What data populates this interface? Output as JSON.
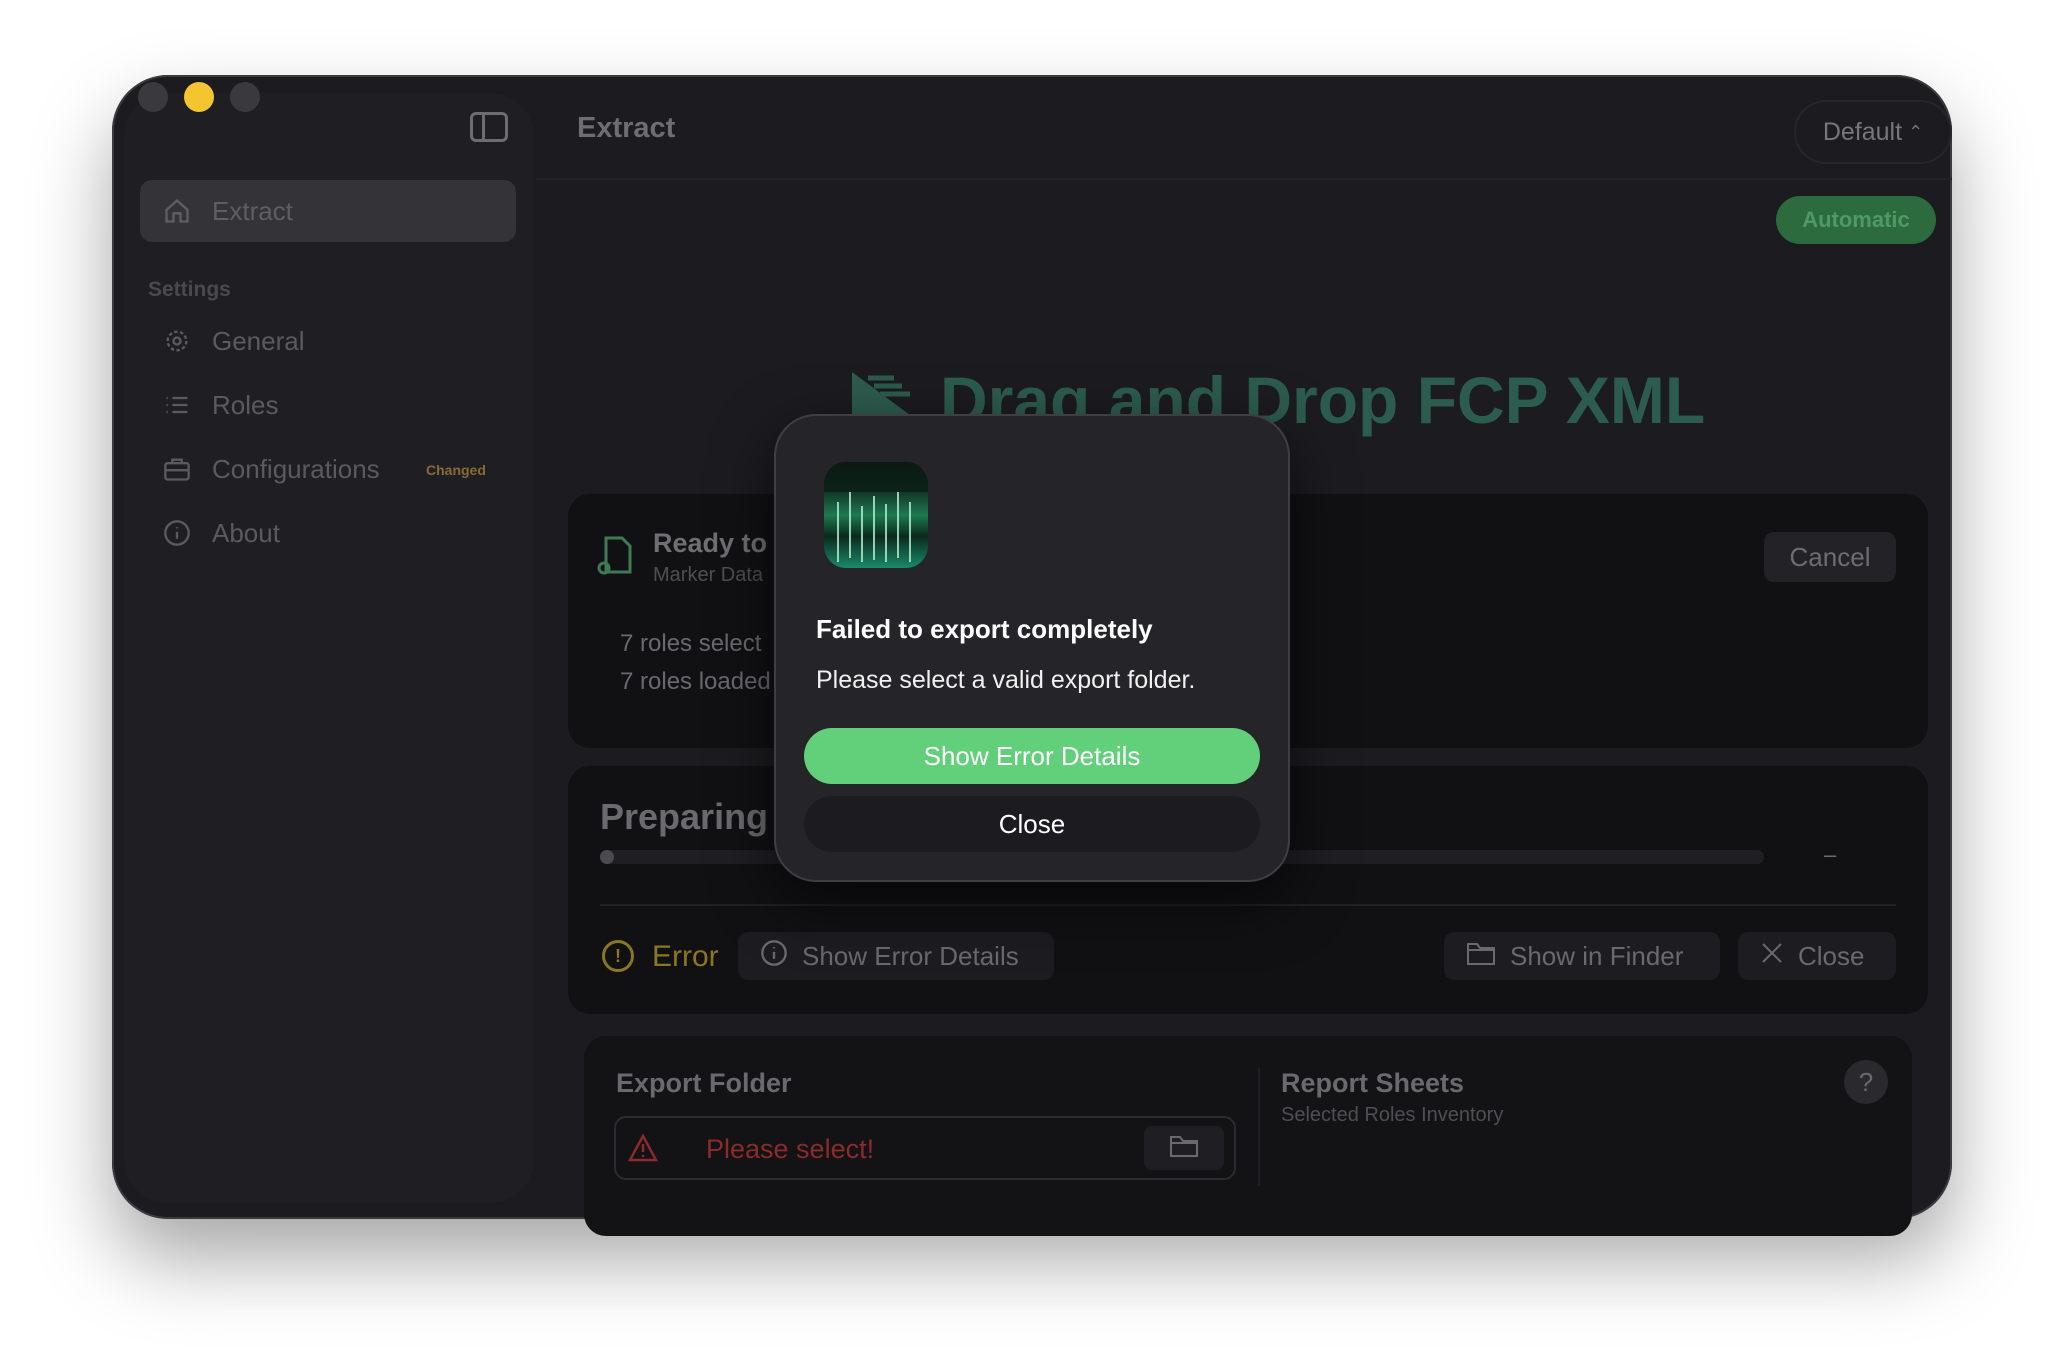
{
  "window": {
    "title": "Extract",
    "preset": "Default",
    "mode_badge": "Automatic"
  },
  "sidebar": {
    "items": [
      {
        "label": "Extract",
        "icon": "house-icon"
      },
      {
        "label": "General",
        "icon": "gear-icon"
      },
      {
        "label": "Roles",
        "icon": "list-icon"
      },
      {
        "label": "Configurations",
        "icon": "briefcase-icon"
      },
      {
        "label": "About",
        "icon": "info-icon"
      }
    ],
    "section_label": "Settings",
    "configurations_badge": "Changed"
  },
  "main": {
    "drop_title": "Drag and Drop FCP XML",
    "ready_title": "Ready to",
    "ready_sub": "Marker Data",
    "roles_selected": "7 roles select",
    "roles_loaded": "7 roles loaded",
    "cancel_label": "Cancel",
    "preparing_label": "Preparing",
    "progress_dash": "–",
    "progress_fraction": 0.005,
    "error_label": "Error",
    "show_error_details_label": "Show Error Details",
    "show_in_finder_label": "Show in Finder",
    "close_label": "Close",
    "export_folder_label": "Export Folder",
    "export_folder_placeholder": "Please select!",
    "report_sheets_label": "Report Sheets",
    "report_sheets_sub": "Selected Roles Inventory",
    "help_label": "?"
  },
  "dialog": {
    "title": "Failed to export completely",
    "message": "Please select a valid export folder.",
    "primary_label": "Show Error Details",
    "secondary_label": "Close"
  },
  "colors": {
    "accent_green": "#62cf7a",
    "warning_yellow": "#8b7624",
    "error_red": "#8b2b2b"
  }
}
